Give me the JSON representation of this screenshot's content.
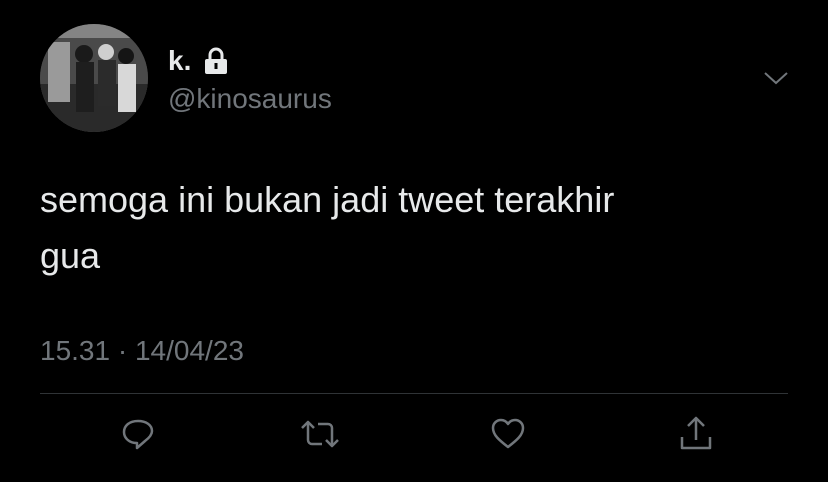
{
  "tweet": {
    "author": {
      "display_name": "k.",
      "handle": "@kinosaurus",
      "protected_icon": "lock-icon",
      "avatar": "profile-photo"
    },
    "text_line_1": "semoga ini bukan jadi tweet terakhir",
    "text_line_2": "gua",
    "time": "15.31",
    "separator": "·",
    "date": "14/04/23",
    "menu_icon": "chevron-down-icon",
    "actions": [
      {
        "icon": "reply-icon"
      },
      {
        "icon": "retweet-icon"
      },
      {
        "icon": "like-icon"
      },
      {
        "icon": "share-icon"
      }
    ]
  },
  "colors": {
    "background": "#000000",
    "text_primary": "#e7e9ea",
    "text_secondary": "#71767b",
    "divider": "#2f3336"
  }
}
